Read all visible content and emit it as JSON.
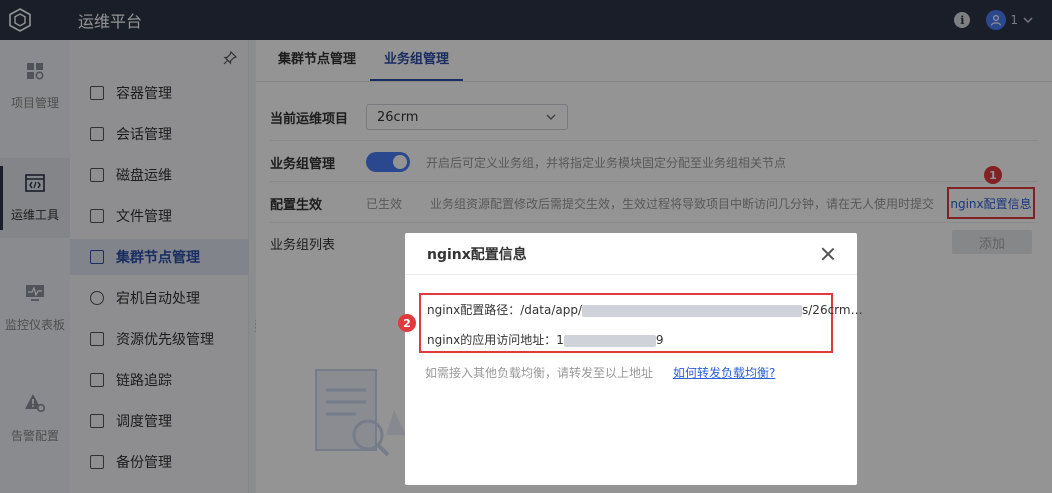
{
  "app": {
    "title": "运维平台"
  },
  "header": {
    "user_label": "1"
  },
  "rail": {
    "items": [
      {
        "label": "项目管理",
        "icon": "grid-icon"
      },
      {
        "label": "运维工具",
        "icon": "code-window-icon"
      },
      {
        "label": "监控仪表板",
        "icon": "monitor-icon"
      },
      {
        "label": "告警配置",
        "icon": "alert-gear-icon"
      }
    ]
  },
  "submenu": {
    "items": [
      {
        "label": "容器管理"
      },
      {
        "label": "会话管理"
      },
      {
        "label": "磁盘运维"
      },
      {
        "label": "文件管理"
      },
      {
        "label": "集群节点管理"
      },
      {
        "label": "宕机自动处理"
      },
      {
        "label": "资源优先级管理"
      },
      {
        "label": "链路追踪"
      },
      {
        "label": "调度管理"
      },
      {
        "label": "备份管理"
      }
    ],
    "active_index": 4
  },
  "tabs": [
    {
      "label": "集群节点管理"
    },
    {
      "label": "业务组管理"
    }
  ],
  "form": {
    "project_label": "当前运维项目",
    "project_value": "26crm",
    "group_mgmt_label": "业务组管理",
    "group_mgmt_hint": "开启后可定义业务组，并将指定业务模块固定分配至业务组相关节点",
    "config_label": "配置生效",
    "config_status": "已生效",
    "config_hint": "业务组资源配置修改后需提交生效，生效过程将导致项目中断访问几分钟，请在无人使用时提交",
    "nginx_link": "nginx配置信息",
    "list_label": "业务组列表",
    "add_button": "添加"
  },
  "badges": {
    "one": "1",
    "two": "2"
  },
  "dialog": {
    "title": "nginx配置信息",
    "path_label": "nginx配置路径：",
    "path_prefix": "/data/app/",
    "path_suffix": "s/26crm…",
    "url_label": "nginx的应用访问地址：",
    "url_prefix": "1",
    "url_suffix": "9",
    "hint": "如需接入其他负载均衡，请转发至以上地址",
    "link": "如何转发负载均衡?"
  },
  "colors": {
    "topbar": "#2d3448",
    "accent": "#2d4fa8",
    "toggle": "#4a7cf7",
    "highlight": "#e0393e",
    "link": "#2d5fd6"
  }
}
